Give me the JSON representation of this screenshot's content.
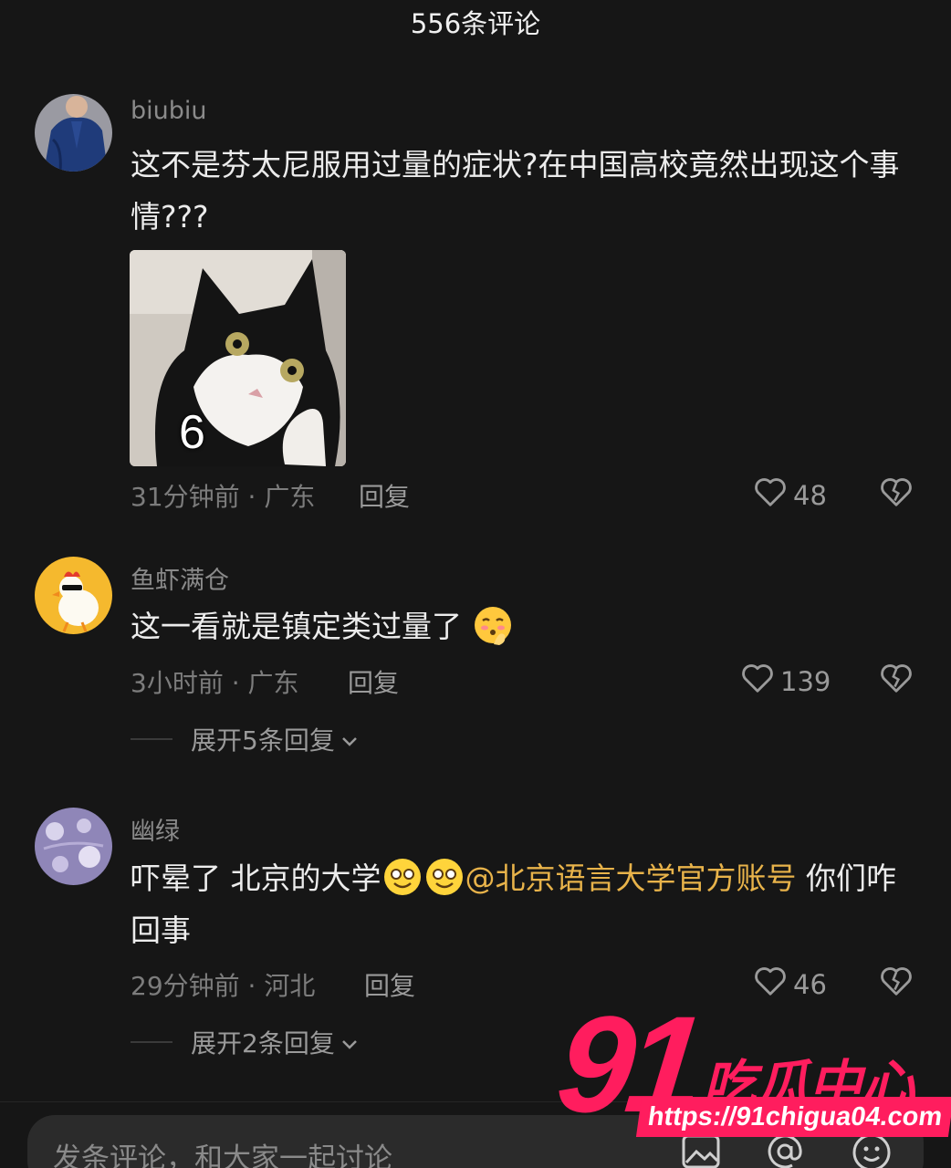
{
  "header": {
    "title": "556条评论"
  },
  "comments": [
    {
      "username": "biubiu",
      "text": "这不是芬太尼服用过量的症状?在中国高校竟然出现这个事情???",
      "sticker_label": "6",
      "time_location": "31分钟前 · 广东",
      "reply_label": "回复",
      "likes": "48"
    },
    {
      "username": "鱼虾满仓",
      "text": "这一看就是镇定类过量了",
      "time_location": "3小时前 · 广东",
      "reply_label": "回复",
      "likes": "139",
      "expand_label": "展开5条回复"
    },
    {
      "username": "幽绿",
      "text_before": "吓晕了 北京的大学",
      "mention": "@北京语言大学官方账号",
      "text_after": " 你们咋回事",
      "time_location": "29分钟前 · 河北",
      "reply_label": "回复",
      "likes": "46",
      "expand_label": "展开2条回复"
    }
  ],
  "input": {
    "placeholder": "发条评论，和大家一起讨论"
  },
  "watermark": {
    "number": "91",
    "text": "吃瓜中心",
    "url": "https://91chigua04.com"
  },
  "colors": {
    "background": "#161616",
    "mention": "#e8b34a",
    "watermark": "#ff1d5e"
  },
  "icons": [
    "heart-icon",
    "broken-heart-icon",
    "chevron-down-icon",
    "image-icon",
    "at-icon",
    "emoji-icon"
  ]
}
